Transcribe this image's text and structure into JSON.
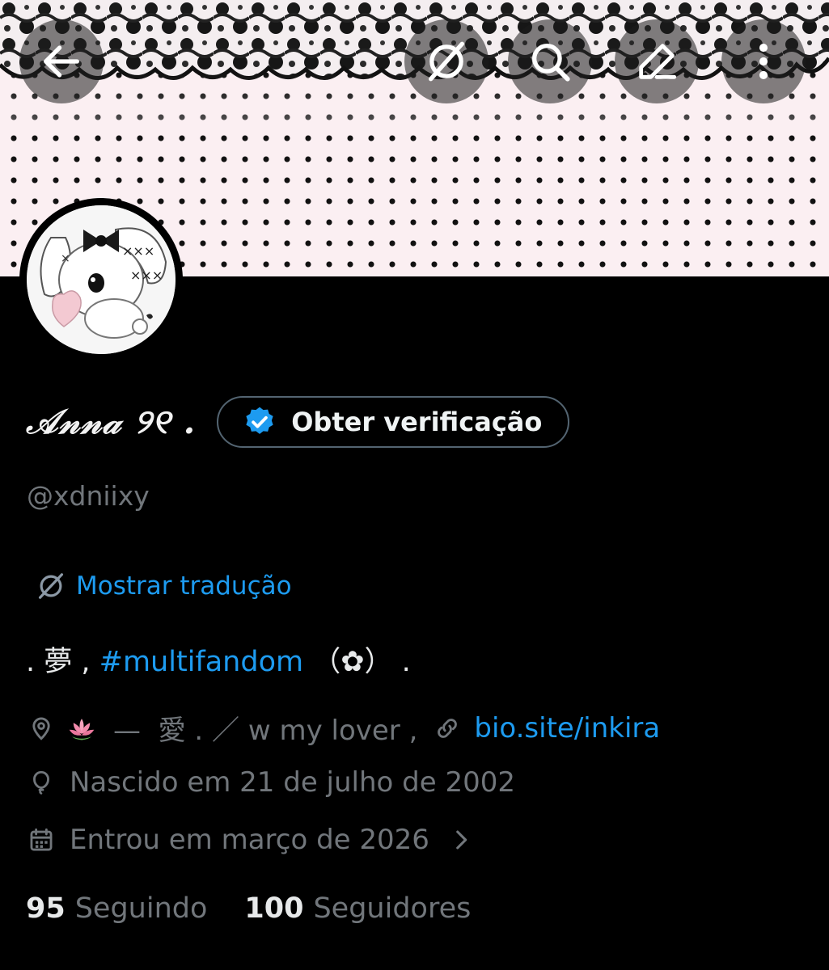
{
  "profile": {
    "display_name": "𝒜𝓃𝓃𝒶 ୨୧ .",
    "handle": "@xdniixy",
    "verify_button_label": "Obter verificação",
    "translate_label": "Mostrar tradução",
    "bio": {
      "prefix": ". 夢 , ",
      "hashtag": "#multifandom",
      "suffix": " （✿） ."
    },
    "location_text": "—  愛 . ／ w my lover ,",
    "location_emoji": "lotus",
    "website": "bio.site/inkira",
    "birthday": "Nascido em 21 de julho de 2002",
    "joined": "Entrou em março de 2026",
    "stats": {
      "following_count": "95",
      "following_label": "Seguindo",
      "followers_count": "100",
      "followers_label": "Seguidores"
    }
  },
  "icons": {
    "back": "arrow-left-icon",
    "no_translate": "translate-off-icon",
    "search": "search-icon",
    "edit": "edit-icon",
    "more": "more-vertical-icon",
    "verified": "verified-badge-icon",
    "location": "location-pin-icon",
    "link": "link-icon",
    "birthday": "balloon-icon",
    "calendar": "calendar-icon"
  },
  "colors": {
    "accent": "#1d9bf0",
    "muted": "#71767b",
    "text": "#e7e9ea",
    "background": "#000000"
  }
}
